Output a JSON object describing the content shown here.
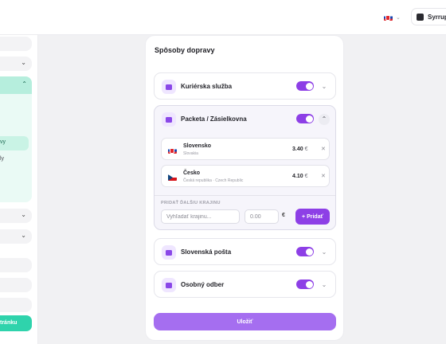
{
  "topbar": {
    "language_flag": "slovakia-flag",
    "store_name": "Syrrup"
  },
  "sidebar": {
    "active_sub_label": "vy",
    "sub_label": "ly",
    "cta_label": "tránku"
  },
  "card": {
    "title": "Spôsoby dopravy",
    "methods": [
      {
        "name": "Kuriérska služba",
        "icon": "truck-icon",
        "enabled": true,
        "expanded": false
      },
      {
        "name": "Packeta / Zásielkovna",
        "icon": "box-icon",
        "enabled": true,
        "expanded": true
      },
      {
        "name": "Slovenská pošta",
        "icon": "truck-icon",
        "enabled": true,
        "expanded": false
      },
      {
        "name": "Osobný odber",
        "icon": "store-icon",
        "enabled": true,
        "expanded": false
      }
    ],
    "countries": [
      {
        "name": "Slovensko",
        "subtitle": "Slovakia",
        "flag": "slovakia-flag",
        "price": "3.40",
        "currency": "€",
        "remove": "✕"
      },
      {
        "name": "Česko",
        "subtitle": "Česká republika · Czech Republic",
        "flag": "czech-flag",
        "price": "4.10",
        "currency": "€",
        "remove": "✕"
      }
    ],
    "add_country": {
      "label": "PRIDAŤ ĎALŠIU KRAJINU",
      "search_placeholder": "Vyhľadať krajinu...",
      "price_placeholder": "0.00",
      "currency": "€",
      "button_label": "+ Pridať"
    },
    "save_label": "Uložiť"
  },
  "colors": {
    "accent": "#8d3fe6",
    "accent_light": "#efe6ff",
    "save_button": "#a56ef0",
    "sidebar_accent": "#2fd3ac"
  }
}
